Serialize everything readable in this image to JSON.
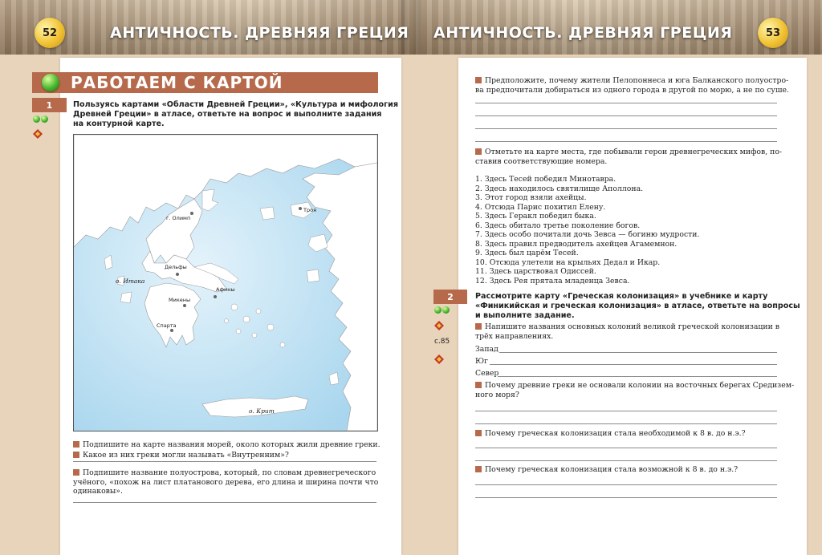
{
  "header": {
    "left_page_number": "52",
    "right_page_number": "53",
    "left_title": "АНТИЧНОСТЬ. ДРЕВНЯЯ ГРЕЦИЯ",
    "right_title": "АНТИЧНОСТЬ. ДРЕВНЯЯ ГРЕЦИЯ"
  },
  "left": {
    "section_title": "РАБОТАЕМ С КАРТОЙ",
    "task1": {
      "number": "1",
      "text_lines": [
        "Пользуясь картами «Области Древней Греции», «Культура и мифология",
        "Древней Греции» в атласе,  ответьте на вопрос и выполните задания",
        "на контурной карте."
      ]
    },
    "map_labels": {
      "olympus": "г. Олимп",
      "troy": "Троя",
      "delphi": "Дельфы",
      "ithaca": "о. Итака",
      "athens": "Афины",
      "mycenae": "Микены",
      "sparta": "Спарта",
      "crete": "о. Крит"
    },
    "q1": [
      "Подпишите на карте названия морей, около которых жили древние греки."
    ],
    "q2": [
      "Какое из них греки могли называть «Внутренним»?"
    ],
    "q3": [
      "Подпишите название полуострова, который, по словам древнегреческого",
      "учёного, «похож на лист платанового дерева, его длина и ширина почти что",
      "одинаковы»."
    ]
  },
  "right": {
    "q_pelopon": [
      "Предположите, почему жители Пелопоннеса и юга Балканского полуостро-",
      "ва предпочитали добираться из одного города в другой по морю, а не по суше."
    ],
    "q_mark": [
      "Отметьте на карте места, где побывали герои древнегреческих мифов, по-",
      "ставив соответствующие номера."
    ],
    "myth_list": [
      "1. Здесь Тесей победил Минотавра.",
      "2. Здесь находилось святилище Аполлона.",
      "3. Этот город взяли ахейцы.",
      "4. Отсюда Парис похитил Елену.",
      "5. Здесь Геракл победил быка.",
      "6. Здесь обитало третье поколение богов.",
      "7. Здесь особо почитали дочь Зевса — богиню мудрости.",
      "8. Здесь правил предводитель ахейцев Агамемнон.",
      "9. Здесь был царём Тесей.",
      "10. Отсюда улетели на крыльях Дедал и Икар.",
      "11. Здесь царствовал Одиссей.",
      "12. Здесь Рея прятала младенца Зевса."
    ],
    "task2": {
      "number": "2",
      "text_lines": [
        "Рассмотрите карту «Греческая колонизация» в учебнике и карту",
        "«Финикийская и греческая колонизация» в атласе, ответьте на вопросы",
        "и выполните задание."
      ],
      "page_ref": "с.85"
    },
    "q_colonies": [
      "Напишите названия основных колоний великой греческой колонизации в",
      "трёх направлениях."
    ],
    "directions": {
      "west": "Запад",
      "south": "Юг",
      "north": "Север"
    },
    "q_east": [
      "Почему древние греки не основали колонии на восточных берегах Средизем-",
      "ного моря?"
    ],
    "q_necessary": [
      "Почему греческая колонизация стала необходимой к 8 в. до н.э.?"
    ],
    "q_possible": [
      "Почему греческая колонизация стала возможной к 8 в. до н.э.?"
    ]
  },
  "colors": {
    "accent": "#b66a4b",
    "sea": "#cfe9f6",
    "land": "#ffffff"
  },
  "icons": [
    "green-ball-icon",
    "green-dots-icon",
    "atlas-icon",
    "textbook-icon"
  ]
}
